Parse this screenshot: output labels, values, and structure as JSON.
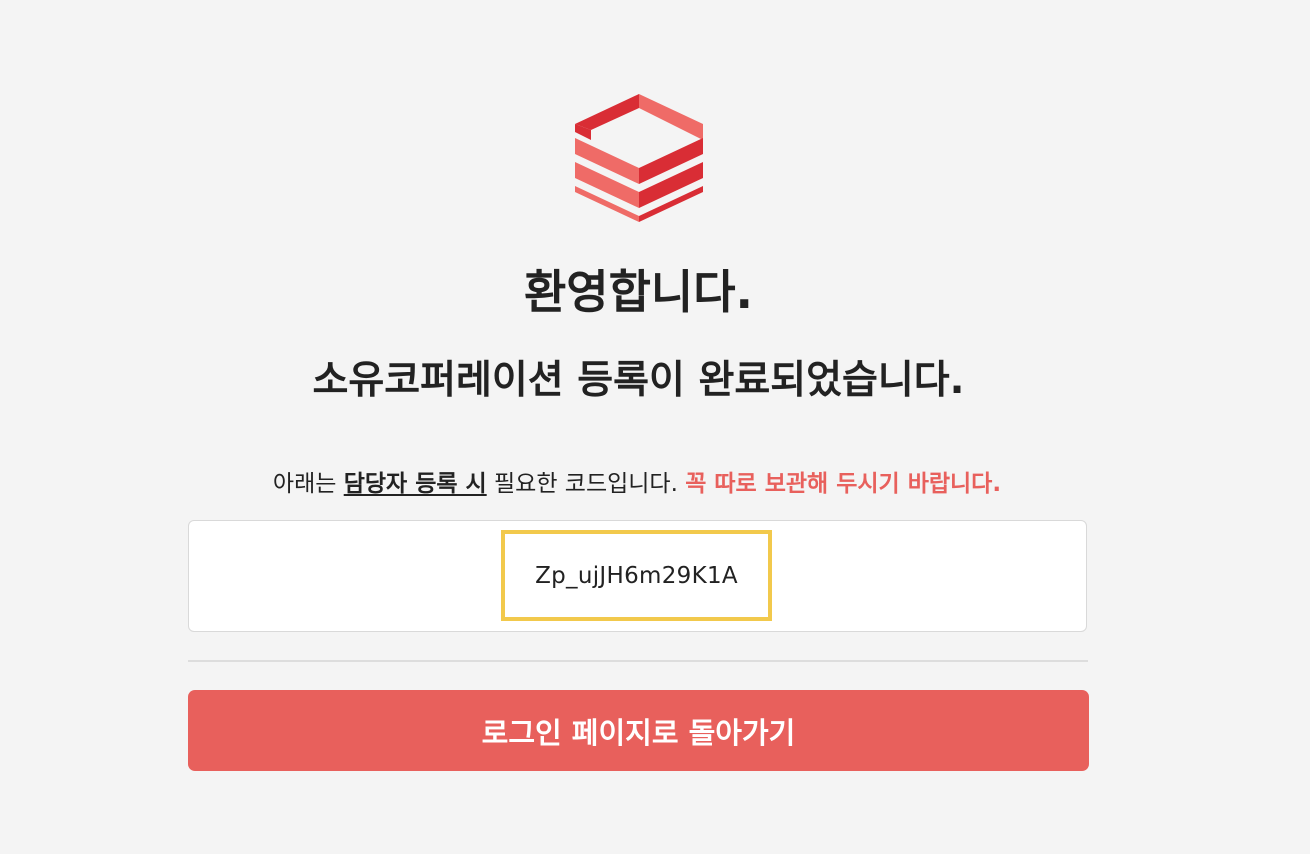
{
  "logo": {
    "icon": "stacked-boxes-logo-icon",
    "colors": {
      "light": "#ef6b67",
      "dark": "#d92d35"
    }
  },
  "heading": {
    "welcome": "환영합니다.",
    "complete": "소유코퍼레이션 등록이 완료되었습니다."
  },
  "notice": {
    "prefix": "아래는 ",
    "emphasis": "담당자 등록 시",
    "middle": " 필요한 코드입니다. ",
    "warning": "꼭 따로 보관해 두시기 바랍니다."
  },
  "code": {
    "value": "Zp_ujJH6m29K1A"
  },
  "actions": {
    "back_to_login": "로그인 페이지로 돌아가기"
  },
  "colors": {
    "accent": "#e8605c",
    "highlight_border": "#f2c94c",
    "background": "#f4f4f4"
  }
}
